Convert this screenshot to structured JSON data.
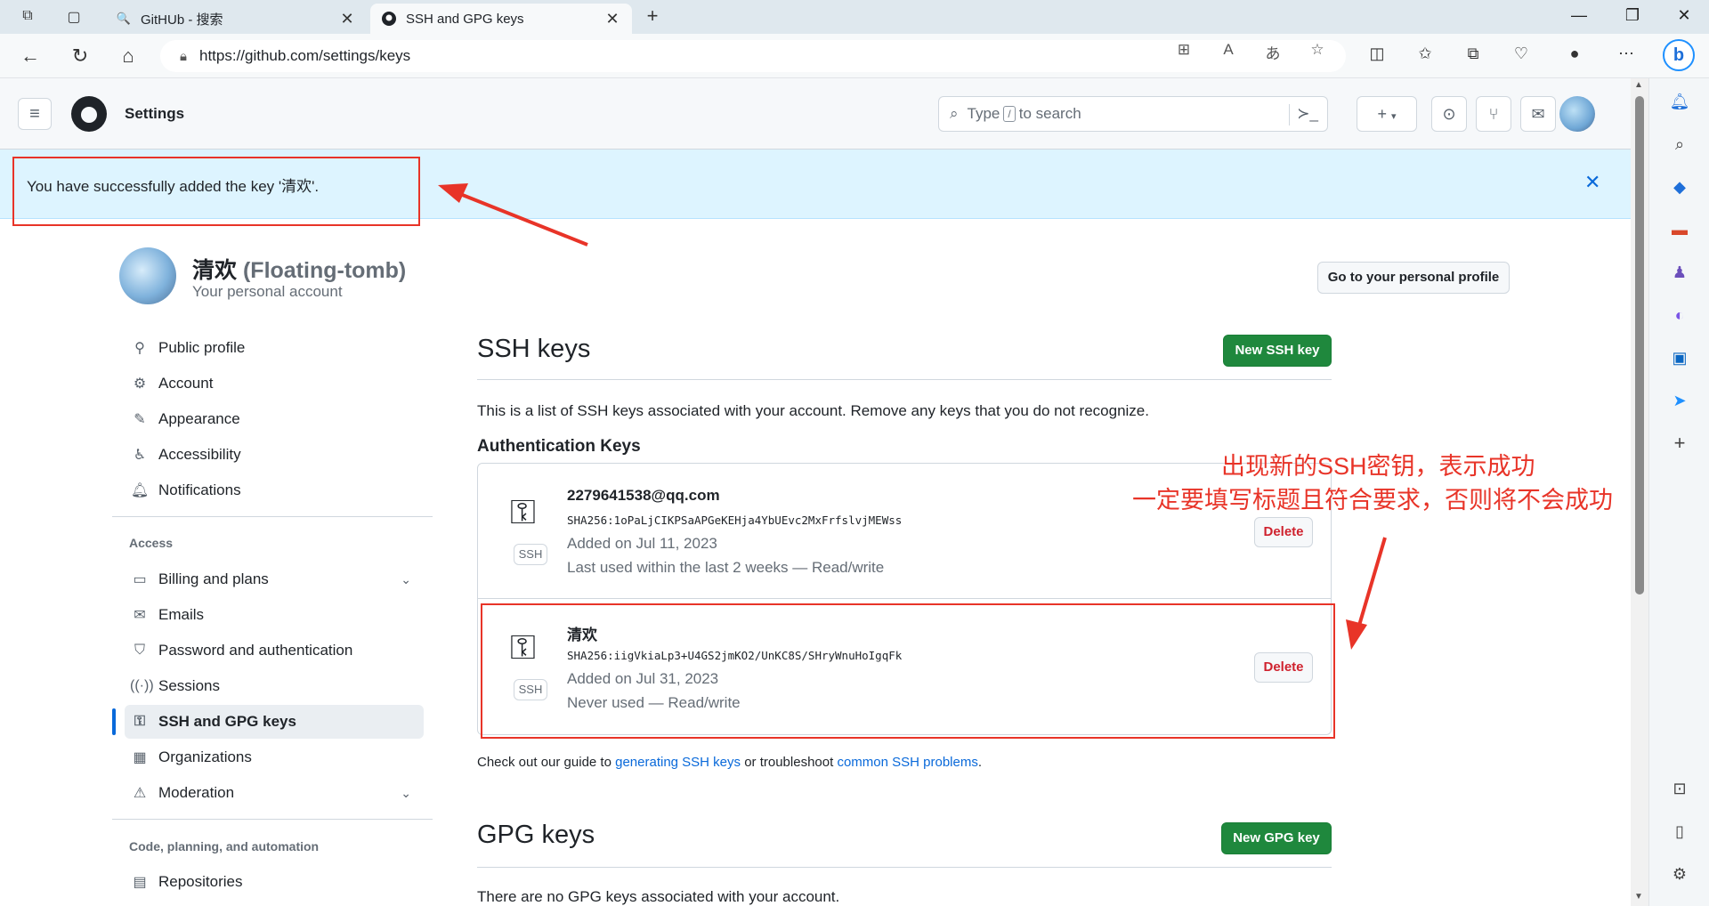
{
  "browser": {
    "tabs": [
      {
        "title": "GitHUb - 搜索",
        "active": false
      },
      {
        "title": "SSH and GPG keys",
        "active": true
      }
    ],
    "url": "https://github.com/settings/keys"
  },
  "header": {
    "title": "Settings",
    "search_prefix": "Type",
    "search_key": "/",
    "search_suffix": "to search"
  },
  "flash": {
    "message": "You have successfully added the key '清欢'."
  },
  "profile": {
    "name": "清欢",
    "login": "(Floating-tomb)",
    "subtitle": "Your personal account",
    "go_to_profile": "Go to your personal profile"
  },
  "nav": {
    "items_top": [
      {
        "label": "Public profile",
        "icon": "person-icon"
      },
      {
        "label": "Account",
        "icon": "gear-icon"
      },
      {
        "label": "Appearance",
        "icon": "paintbrush-icon"
      },
      {
        "label": "Accessibility",
        "icon": "accessibility-icon"
      },
      {
        "label": "Notifications",
        "icon": "bell-icon"
      }
    ],
    "access_heading": "Access",
    "items_access": [
      {
        "label": "Billing and plans",
        "icon": "credit-card-icon"
      },
      {
        "label": "Emails",
        "icon": "mail-icon"
      },
      {
        "label": "Password and authentication",
        "icon": "shield-icon"
      },
      {
        "label": "Sessions",
        "icon": "broadcast-icon"
      },
      {
        "label": "SSH and GPG keys",
        "icon": "key-icon"
      },
      {
        "label": "Organizations",
        "icon": "organization-icon"
      },
      {
        "label": "Moderation",
        "icon": "report-icon"
      }
    ],
    "code_heading": "Code, planning, and automation",
    "items_code": [
      {
        "label": "Repositories",
        "icon": "repo-icon"
      }
    ]
  },
  "ssh": {
    "title": "SSH keys",
    "new_button": "New SSH key",
    "description": "This is a list of SSH keys associated with your account. Remove any keys that you do not recognize.",
    "auth_heading": "Authentication Keys",
    "badge": "SSH",
    "delete_label": "Delete",
    "keys": [
      {
        "title": "2279641538@qq.com",
        "fingerprint": "SHA256:1oPaLjCIKPSaAPGeKEHja4YbUEvc2MxFrfslvjMEWss",
        "added": "Added on Jul 11, 2023",
        "usage": "Last used within the last 2 weeks — Read/write"
      },
      {
        "title": "清欢",
        "fingerprint": "SHA256:iigVkiaLp3+U4GS2jmKO2/UnKC8S/SHryWnuHoIgqFk",
        "added": "Added on Jul 31, 2023",
        "usage": "Never used — Read/write"
      }
    ],
    "guide_prefix": "Check out our guide to",
    "guide_link1": "generating SSH keys",
    "guide_middle": "or troubleshoot",
    "guide_link2": "common SSH problems",
    "guide_suffix": "."
  },
  "gpg": {
    "title": "GPG keys",
    "new_button": "New GPG key",
    "description": "There are no GPG keys associated with your account."
  },
  "annotation": {
    "line1": "出现新的SSH密钥，表示成功",
    "line2": "一定要填写标题且符合要求，否则将不会成功"
  },
  "colors": {
    "accent": "#0969da",
    "green": "#1f883d",
    "danger": "#cf222e",
    "annotation_red": "#e83428",
    "flash_bg": "#ddf4ff"
  }
}
